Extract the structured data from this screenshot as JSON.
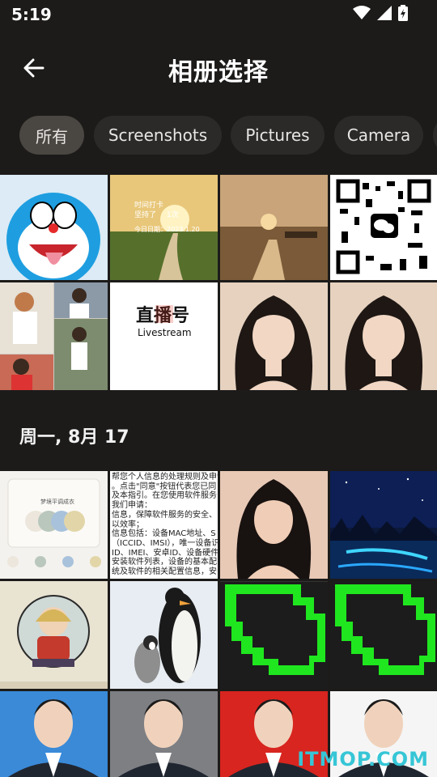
{
  "status": {
    "time": "5:19"
  },
  "header": {
    "title": "相册选择",
    "back_icon": "arrow-left-icon"
  },
  "tabs": [
    {
      "label": "所有",
      "active": true
    },
    {
      "label": "Screenshots",
      "active": false
    },
    {
      "label": "Pictures",
      "active": false
    },
    {
      "label": "Camera",
      "active": false
    }
  ],
  "section": {
    "date": "周一, 8月 17"
  },
  "thumbs": {
    "poster1_line1": "时间打卡",
    "poster1_line2": "坚持了",
    "poster1_line3": "1次",
    "poster1_line4": "今日日期：2023.1.20",
    "live_brand": "直播号",
    "live_sub": "Livestream",
    "palette_title": "梦境平调成衣",
    "doc_lines": [
      "帮您个人信息的处理规则及申请",
      "。点击\"同意\"按钮代表您已同",
      "及本指引。在您使用软件服务",
      "我们申请：",
      "信息，保障软件服务的安全、",
      "以效率；",
      "信息包括：设备MAC地址、S",
      "（ICCID、IMSI），唯一设备识",
      "ID、IMEI、安卓ID、设备硬件",
      "安装软件列表，设备的基本配",
      "统及软件的相关配置信息，安"
    ]
  },
  "watermark": "ITMOP.COM",
  "colors": {
    "background": "#1c1b1a",
    "chip": "#2b2a29",
    "chip_active": "#4a4642",
    "watermark": "#36c6d6"
  }
}
